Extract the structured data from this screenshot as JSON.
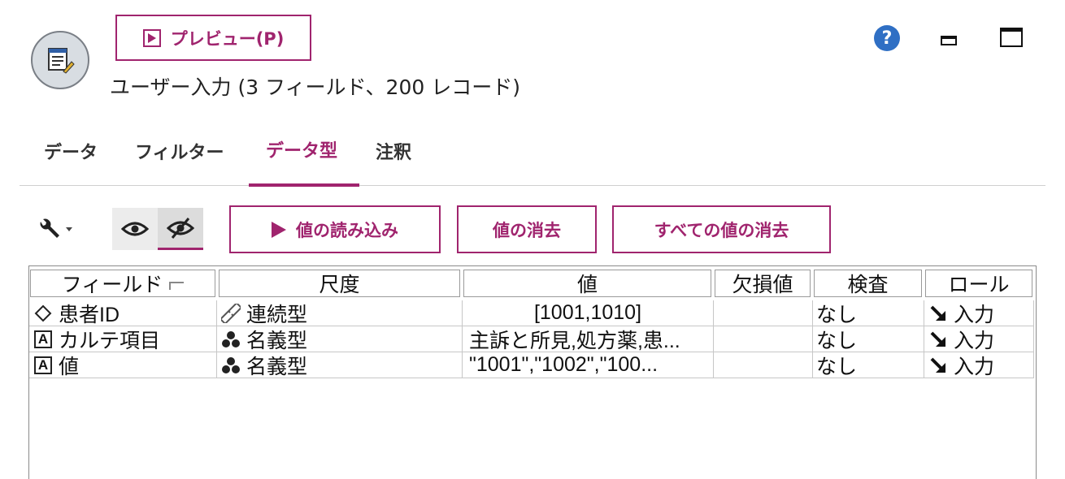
{
  "header": {
    "preview_label": "プレビュー(P)",
    "node_title": "ユーザー入力 (3 フィールド、200 レコード)",
    "help_glyph": "?"
  },
  "tabs": [
    {
      "label": "データ",
      "active": false
    },
    {
      "label": "フィルター",
      "active": false
    },
    {
      "label": "データ型",
      "active": true
    },
    {
      "label": "注釈",
      "active": false
    }
  ],
  "toolbar": {
    "read_values_label": "値の読み込み",
    "clear_values_label": "値の消去",
    "clear_all_values_label": "すべての値の消去"
  },
  "table": {
    "columns": [
      "フィールド",
      "尺度",
      "値",
      "欠損値",
      "検査",
      "ロール"
    ],
    "rows": [
      {
        "field": "患者ID",
        "field_icon": "continuous-diamond-icon",
        "measure": "連続型",
        "measure_icon": "ruler-icon",
        "values": "[1001,1010]",
        "missing": "",
        "check": "なし",
        "role": "入力",
        "role_icon": "input-arrow-icon"
      },
      {
        "field": "カルテ項目",
        "field_icon": "string-a-icon",
        "measure": "名義型",
        "measure_icon": "nominal-circles-icon",
        "values": "主訴と所見,処方薬,患...",
        "missing": "",
        "check": "なし",
        "role": "入力",
        "role_icon": "input-arrow-icon"
      },
      {
        "field": "値",
        "field_icon": "string-a-icon",
        "measure": "名義型",
        "measure_icon": "nominal-circles-icon",
        "values": "\"1001\",\"1002\",\"100...",
        "missing": "",
        "check": "なし",
        "role": "入力",
        "role_icon": "input-arrow-icon"
      }
    ]
  },
  "colors": {
    "accent": "#a0246e",
    "help": "#2f6fc4"
  }
}
